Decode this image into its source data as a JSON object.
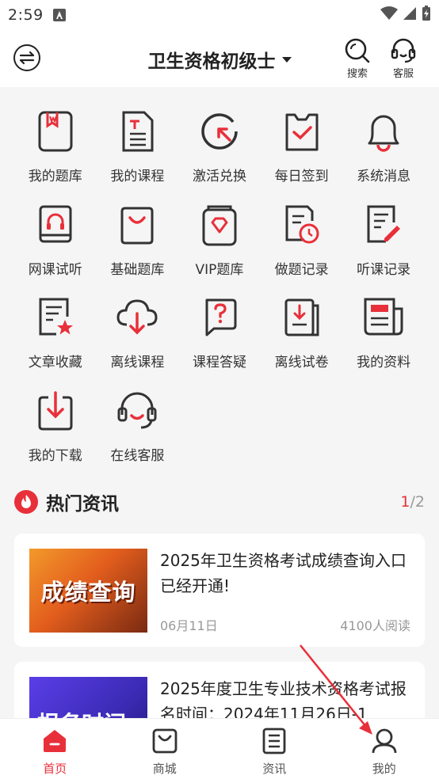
{
  "status_bar": {
    "time": "2:59",
    "notification_icon": "a-notification-icon",
    "wifi_icon": "wifi-icon",
    "signal_icon": "signal-icon",
    "battery_icon": "battery-charging-icon"
  },
  "header": {
    "menu_icon": "swap-menu-icon",
    "title": "卫生资格初级士",
    "search_label": "搜索",
    "service_label": "客服"
  },
  "grid": {
    "items": [
      {
        "label": "我的题库",
        "icon": "question-bank-icon"
      },
      {
        "label": "我的课程",
        "icon": "course-doc-icon"
      },
      {
        "label": "激活兑换",
        "icon": "activate-arrow-icon"
      },
      {
        "label": "每日签到",
        "icon": "checkin-icon"
      },
      {
        "label": "系统消息",
        "icon": "bell-icon"
      },
      {
        "label": "网课试听",
        "icon": "headphone-book-icon"
      },
      {
        "label": "基础题库",
        "icon": "bag-icon"
      },
      {
        "label": "VIP题库",
        "icon": "vip-diamond-icon"
      },
      {
        "label": "做题记录",
        "icon": "record-clock-icon"
      },
      {
        "label": "听课记录",
        "icon": "note-pen-icon"
      },
      {
        "label": "文章收藏",
        "icon": "article-star-icon"
      },
      {
        "label": "离线课程",
        "icon": "cloud-download-icon"
      },
      {
        "label": "课程答疑",
        "icon": "question-bubble-icon"
      },
      {
        "label": "离线试卷",
        "icon": "paper-download-icon"
      },
      {
        "label": "我的资料",
        "icon": "newspaper-icon"
      },
      {
        "label": "我的下载",
        "icon": "download-box-icon"
      },
      {
        "label": "在线客服",
        "icon": "headset-icon"
      }
    ]
  },
  "news": {
    "title": "热门资讯",
    "pager_current": "1",
    "pager_total": "/2",
    "items": [
      {
        "thumb_text": "成绩查询",
        "title": "2025年卫生资格考试成绩查询入口已经开通!",
        "date": "06月11日",
        "reads": "4100人阅读"
      },
      {
        "thumb_text": "报名时间",
        "title": "2025年度卫生专业技术资格考试报名时间：2024年11月26日-1"
      }
    ]
  },
  "bottom_nav": {
    "items": [
      {
        "label": "首页",
        "icon": "home-icon",
        "active": true
      },
      {
        "label": "商城",
        "icon": "shop-bag-icon",
        "active": false
      },
      {
        "label": "资讯",
        "icon": "news-doc-icon",
        "active": false
      },
      {
        "label": "我的",
        "icon": "profile-icon",
        "active": false
      }
    ]
  },
  "colors": {
    "accent": "#e8303a",
    "text": "#222222",
    "muted": "#999999",
    "background": "#f5f5f5"
  }
}
